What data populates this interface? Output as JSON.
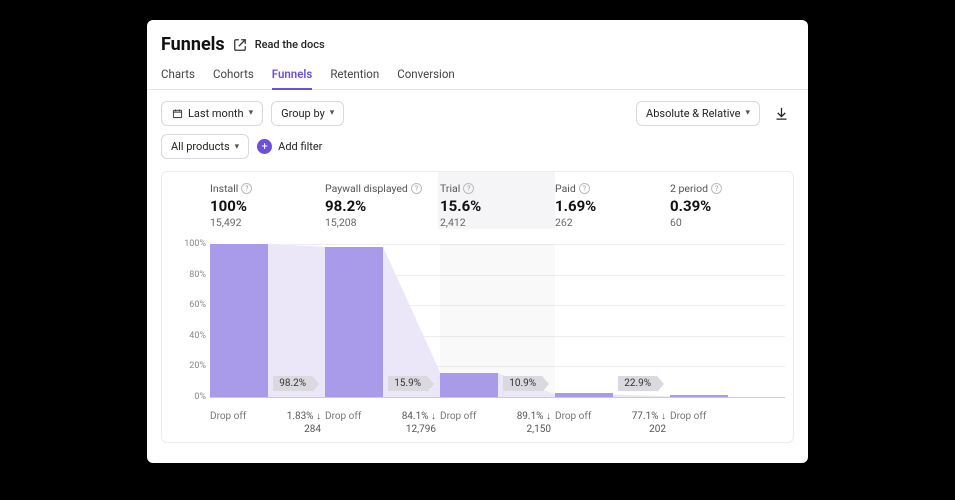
{
  "header": {
    "title": "Funnels",
    "docs_link": "Read the docs"
  },
  "tabs": [
    "Charts",
    "Cohorts",
    "Funnels",
    "Retention",
    "Conversion"
  ],
  "active_tab_index": 2,
  "controls": {
    "date_range": "Last month",
    "group_by": "Group by",
    "mode": "Absolute & Relative",
    "products": "All products",
    "add_filter": "Add filter"
  },
  "colors": {
    "accent": "#6d4fe0",
    "bar": "#a99be9"
  },
  "chart_data": {
    "type": "bar",
    "title": "",
    "ylabel": "",
    "xlabel": "",
    "ylim": [
      0,
      100
    ],
    "yticks": [
      "100%",
      "80%",
      "60%",
      "40%",
      "20%",
      "0%"
    ],
    "highlighted_step_index": 2,
    "steps": [
      {
        "name": "Install",
        "percent": 100,
        "percent_label": "100%",
        "count": "15,492",
        "conversion_to_next": "98.2%",
        "drop_off_pct": "1.83%",
        "drop_off_count": "284"
      },
      {
        "name": "Paywall displayed",
        "percent": 98.2,
        "percent_label": "98.2%",
        "count": "15,208",
        "conversion_to_next": "15.9%",
        "drop_off_pct": "84.1%",
        "drop_off_count": "12,796"
      },
      {
        "name": "Trial",
        "percent": 15.6,
        "percent_label": "15.6%",
        "count": "2,412",
        "conversion_to_next": "10.9%",
        "drop_off_pct": "89.1%",
        "drop_off_count": "2,150"
      },
      {
        "name": "Paid",
        "percent": 1.69,
        "percent_label": "1.69%",
        "count": "262",
        "conversion_to_next": "22.9%",
        "drop_off_pct": "77.1%",
        "drop_off_count": "202"
      },
      {
        "name": "2 period",
        "percent": 0.39,
        "percent_label": "0.39%",
        "count": "60",
        "conversion_to_next": null,
        "drop_off_pct": null,
        "drop_off_count": null
      }
    ],
    "drop_off_label": "Drop off"
  }
}
